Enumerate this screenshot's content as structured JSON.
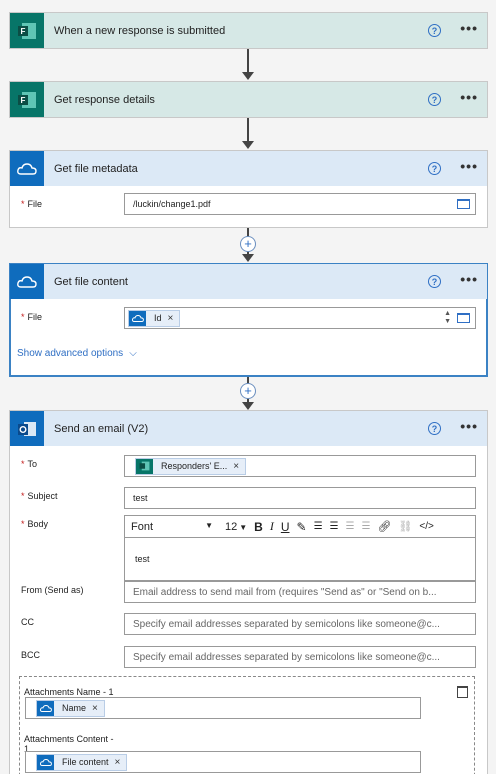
{
  "steps": [
    {
      "title": "When a new response is submitted"
    },
    {
      "title": "Get response details"
    },
    {
      "title": "Get file metadata",
      "file_label": "File",
      "file_value": "/luckin/change1.pdf"
    },
    {
      "title": "Get file content",
      "file_label": "File",
      "file_token": "Id",
      "advanced": "Show advanced options"
    },
    {
      "title": "Send an email (V2)"
    }
  ],
  "help_glyph": "?",
  "more_glyph": "•••",
  "email": {
    "to_label": "To",
    "to_token": "Responders' E...",
    "subject_label": "Subject",
    "subject_value": "test",
    "body_label": "Body",
    "font_name": "Font",
    "font_size": "12",
    "body_value": "test",
    "from_label": "From (Send as)",
    "from_placeholder": "Email address to send mail from (requires \"Send as\" or \"Send on b...",
    "cc_label": "CC",
    "cc_placeholder": "Specify email addresses separated by semicolons like someone@c...",
    "bcc_label": "BCC",
    "bcc_placeholder": "Specify email addresses separated by semicolons like someone@c...",
    "attach_name_label": "Attachments Name - 1",
    "attach_name_token": "Name",
    "attach_content_label": "Attachments Content -",
    "attach_content_label2": "1",
    "attach_content_token": "File content"
  },
  "token_remove": "×",
  "req_marker": "*",
  "plus_glyph": "+",
  "colors": {
    "forms": "#077568",
    "onedrive": "#0f6cbd",
    "outlook": "#0f6cbd",
    "link": "#2f6fc4"
  }
}
